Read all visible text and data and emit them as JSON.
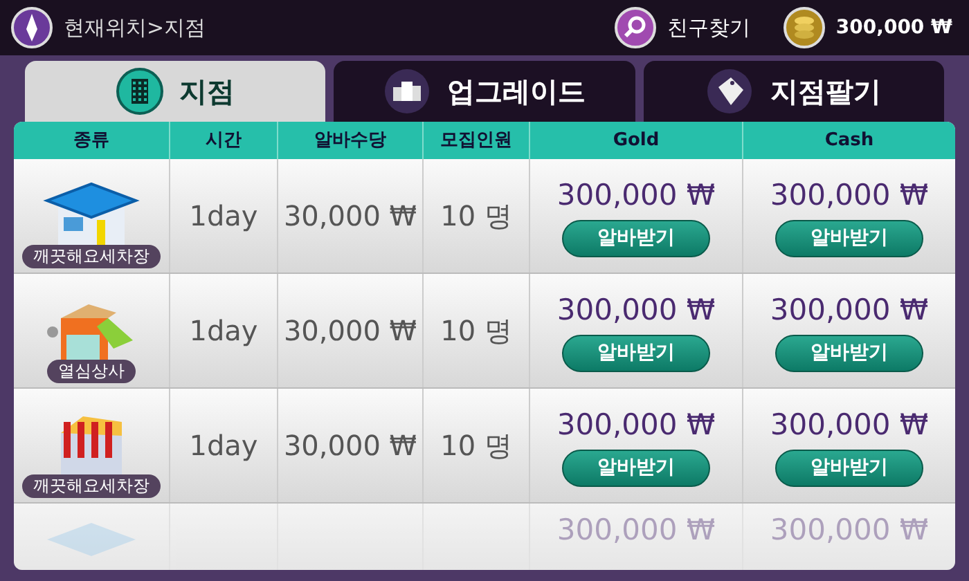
{
  "top_bar": {
    "location": "현재위치>지점",
    "friend_button": "친구찾기",
    "balance": "300,000 ₩"
  },
  "tabs": [
    {
      "label": "지점",
      "selected": true,
      "kind": "building"
    },
    {
      "label": "업그레이드",
      "selected": false,
      "kind": "city"
    },
    {
      "label": "지점팔기",
      "selected": false,
      "kind": "sale"
    }
  ],
  "table": {
    "columns": [
      "종류",
      "시간",
      "알바수당",
      "모집인원",
      "Gold",
      "Cash"
    ],
    "rows": [
      {
        "kind": "carwash",
        "name": "깨끗해요세차장",
        "time": "1day",
        "pay": "30,000 ₩",
        "staff": "10 명",
        "gold": "300,000 ₩",
        "gold_button": "알바받기",
        "cash": "300,000 ₩",
        "cash_button": "알바받기"
      },
      {
        "kind": "cafe",
        "name": "열심상사",
        "time": "1day",
        "pay": "30,000 ₩",
        "staff": "10 명",
        "gold": "300,000 ₩",
        "gold_button": "알바받기",
        "cash": "300,000 ₩",
        "cash_button": "알바받기"
      },
      {
        "kind": "shop",
        "name": "깨끗해요세차장",
        "time": "1day",
        "pay": "30,000 ₩",
        "staff": "10 명",
        "gold": "300,000 ₩",
        "gold_button": "알바받기",
        "cash": "300,000 ₩",
        "cash_button": "알바받기"
      },
      {
        "kind": "faded",
        "gold": "300,000 ₩",
        "cash": "300,000 ₩"
      }
    ]
  }
}
